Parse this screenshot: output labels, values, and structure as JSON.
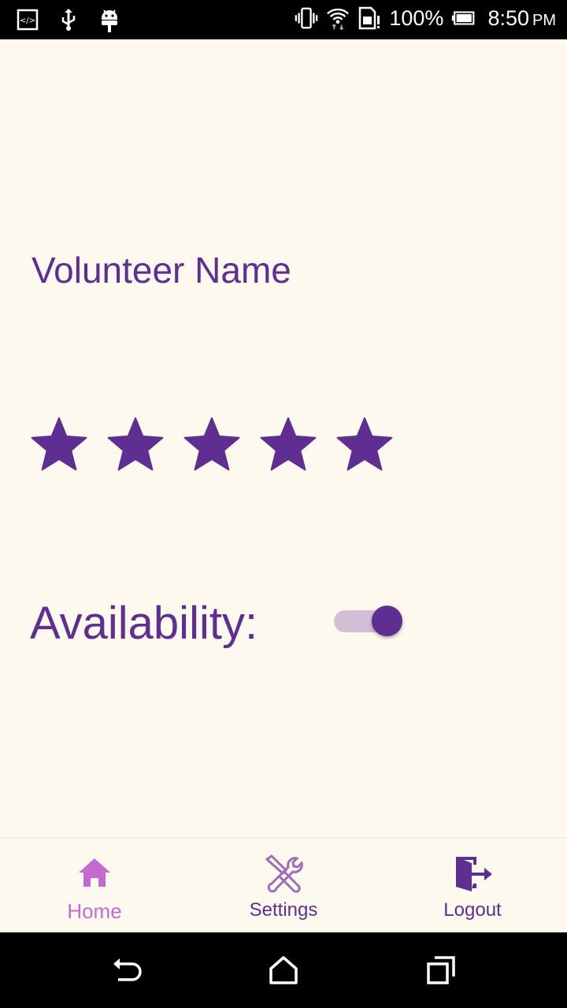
{
  "status_bar": {
    "battery_percent": "100%",
    "time": "8:50",
    "ampm": "PM"
  },
  "profile": {
    "name_label": "Volunteer Name",
    "rating": 5,
    "rating_max": 5,
    "availability_label": "Availability:",
    "availability_on": true
  },
  "bottom_nav": {
    "items": [
      {
        "label": "Home",
        "icon": "home-icon",
        "active": true
      },
      {
        "label": "Settings",
        "icon": "tools-icon",
        "active": false
      },
      {
        "label": "Logout",
        "icon": "logout-icon",
        "active": false
      }
    ]
  },
  "colors": {
    "primary": "#5e2f91",
    "accent": "#c66ad0",
    "background": "#fdf9ee",
    "toggle_track": "#d3bed8"
  }
}
